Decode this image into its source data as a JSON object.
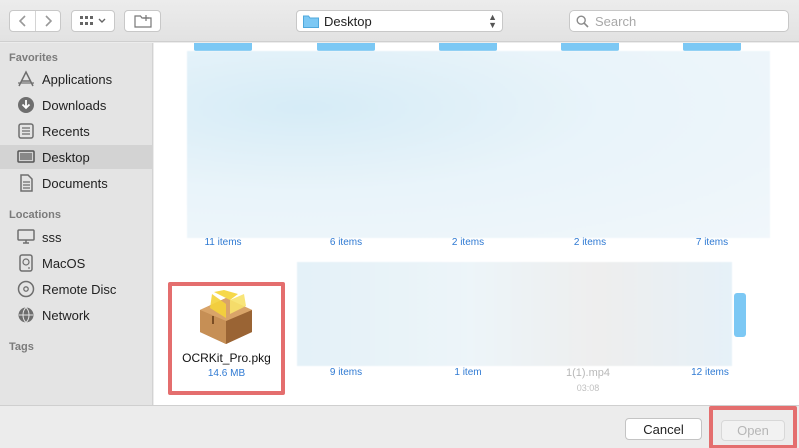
{
  "toolbar": {
    "location": "Desktop",
    "search_placeholder": "Search"
  },
  "sidebar": {
    "favorites_title": "Favorites",
    "favorites": [
      {
        "label": "Applications",
        "icon": "applications-icon"
      },
      {
        "label": "Downloads",
        "icon": "downloads-icon"
      },
      {
        "label": "Recents",
        "icon": "recents-icon"
      },
      {
        "label": "Desktop",
        "icon": "desktop-icon",
        "selected": true
      },
      {
        "label": "Documents",
        "icon": "documents-icon"
      }
    ],
    "locations_title": "Locations",
    "locations": [
      {
        "label": "sss",
        "icon": "computer-icon"
      },
      {
        "label": "MacOS",
        "icon": "disk-icon"
      },
      {
        "label": "Remote Disc",
        "icon": "remote-disc-icon"
      },
      {
        "label": "Network",
        "icon": "network-icon"
      }
    ],
    "tags_title": "Tags"
  },
  "files": {
    "row1_counts": [
      "11 items",
      "6 items",
      "2 items",
      "2 items",
      "7 items"
    ],
    "row2_counts": [
      "9 items",
      "1 item",
      "12 items"
    ],
    "video_name": "1(1).mp4",
    "video_duration": "03:08",
    "pkg_name": "OCRKit_Pro.pkg",
    "pkg_size": "14.6 MB"
  },
  "buttons": {
    "cancel": "Cancel",
    "open": "Open"
  },
  "colors": {
    "accent": "#2f7ad3",
    "folder_blue": "#7cc8f4",
    "highlight_red": "#e46e6e"
  }
}
